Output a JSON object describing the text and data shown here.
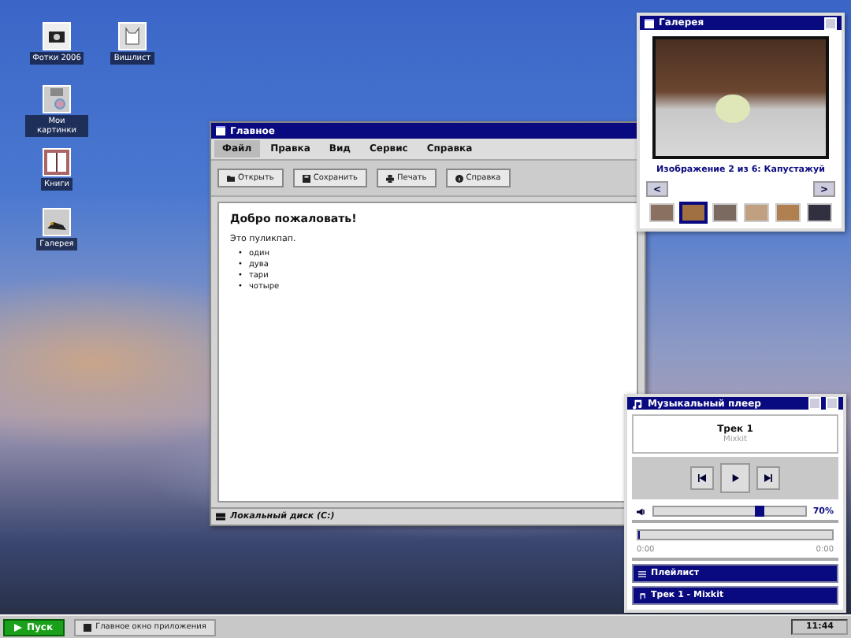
{
  "desktop_icons": [
    {
      "label": "Фотки 2006",
      "kind": "photos"
    },
    {
      "label": "Вишлист",
      "kind": "wishlist"
    },
    {
      "label": "Мои картинки",
      "kind": "disk"
    },
    {
      "label": "Книги",
      "kind": "book"
    },
    {
      "label": "Галерея",
      "kind": "gallery"
    }
  ],
  "main_window": {
    "title": "Главное",
    "menu": [
      {
        "label": "Файл",
        "selected": true
      },
      {
        "label": "Правка",
        "selected": false
      },
      {
        "label": "Вид",
        "selected": false
      },
      {
        "label": "Сервис",
        "selected": false
      },
      {
        "label": "Справка",
        "selected": false
      }
    ],
    "toolbar": [
      {
        "label": "Открыть",
        "kind": "open"
      },
      {
        "label": "Сохранить",
        "kind": "save"
      },
      {
        "label": "Печать",
        "kind": "print"
      },
      {
        "label": "Справка",
        "kind": "help"
      }
    ],
    "heading": "Добро пожаловать!",
    "text": "Это пуликпап.",
    "list": [
      {
        "marker": "•",
        "label": "один"
      },
      {
        "marker": "•",
        "label": "дува"
      },
      {
        "marker": "•",
        "label": "тари"
      },
      {
        "marker": "•",
        "label": "чотыре"
      }
    ],
    "status": "Локальный диск (C:)"
  },
  "gallery": {
    "title": "Галерея",
    "caption": "Изображение 2 из 6: Капустажуй",
    "prev": "<",
    "next": ">",
    "thumbnails": [
      {
        "selected": false
      },
      {
        "selected": true
      },
      {
        "selected": false
      },
      {
        "selected": false
      },
      {
        "selected": false
      },
      {
        "selected": false
      }
    ]
  },
  "player": {
    "title": "Музыкальный плеер",
    "track": "Трек 1",
    "artist": "Mixkit",
    "volume": {
      "level": 0.7,
      "reading": "70%"
    },
    "progress": {
      "level": 0,
      "start": "0:00",
      "end": "0:00"
    },
    "playlist": "Плейлист",
    "now_playing": "Трек 1 - Mixkit"
  },
  "taskbar": {
    "start": "Пуск",
    "tasks": [
      {
        "label": "Главное окно приложения"
      }
    ],
    "clock": "11:44"
  }
}
